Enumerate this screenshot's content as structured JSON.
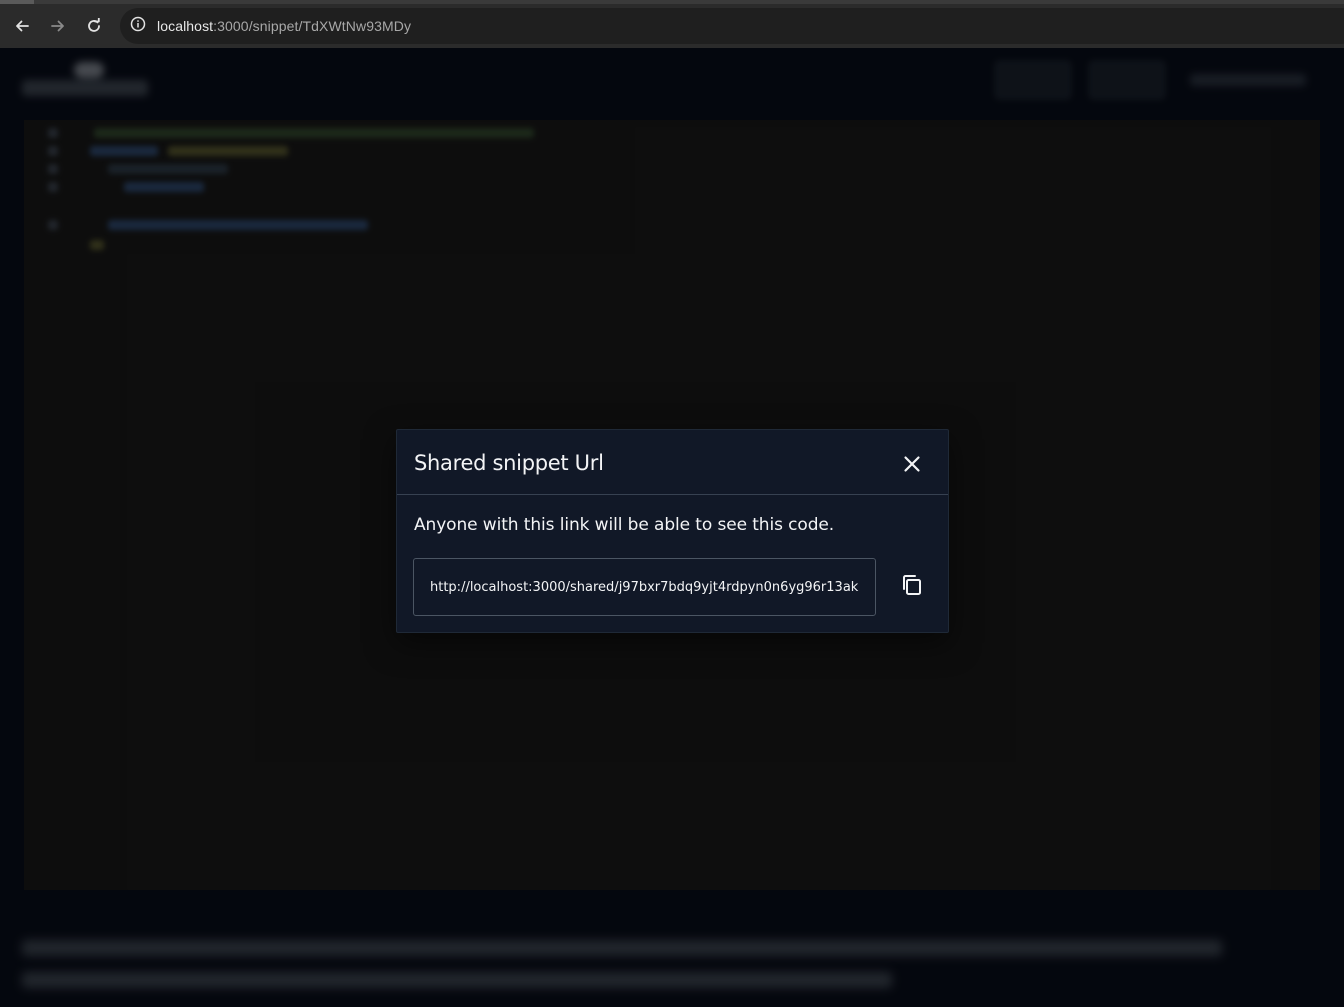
{
  "browser": {
    "url_host": "localhost",
    "url_path": ":3000/snippet/TdXWtNw93MDy",
    "icons": {
      "back": "arrow-left-icon",
      "forward": "arrow-right-icon",
      "reload": "reload-icon",
      "site_info": "info-icon"
    }
  },
  "modal": {
    "title": "Shared snippet Url",
    "description": "Anyone with this link will be able to see this code.",
    "share_url": "http://localhost:3000/shared/j97bxr7bdq9yjt4rdpyn0n6yg96r13ak",
    "icons": {
      "close": "close-icon",
      "copy": "copy-icon"
    }
  },
  "colors": {
    "page_bg": "#0b1120",
    "modal_bg": "#111827",
    "modal_border": "#374151",
    "text": "#f3f4f6",
    "editor_bg": "#1e1e1e"
  }
}
